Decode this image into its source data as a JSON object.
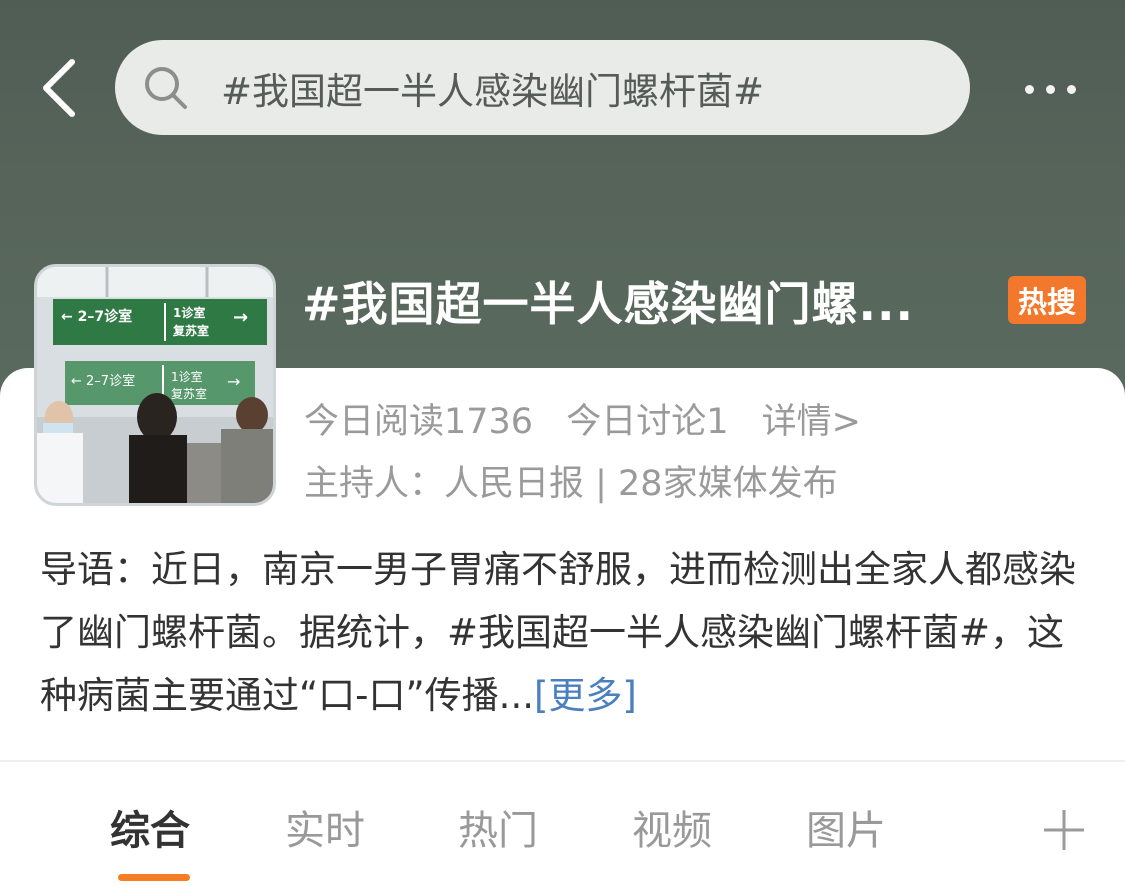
{
  "header": {
    "search_text": "#我国超一半人感染幽门螺杆菌#"
  },
  "topic": {
    "title": "#我国超一半人感染幽门螺...",
    "badge": "热搜",
    "stats": {
      "reads": "今日阅读1736",
      "discussions": "今日讨论1",
      "details": "详情>"
    },
    "host_line": "主持人：人民日报 | 28家媒体发布",
    "thumbnail": {
      "sign_left": "2–7诊室",
      "sign_right_top": "1诊室",
      "sign_right_bottom": "复苏室"
    }
  },
  "intro": {
    "text": "导语：近日，南京一男子胃痛不舒服，进而检测出全家人都感染了幽门螺杆菌。据统计，#我国超一半人感染幽门螺杆菌#，这种病菌主要通过“口-口”传播...",
    "more_label": "[更多]"
  },
  "tabs": [
    {
      "label": "综合",
      "active": true
    },
    {
      "label": "实时",
      "active": false
    },
    {
      "label": "热门",
      "active": false
    },
    {
      "label": "视频",
      "active": false
    },
    {
      "label": "图片",
      "active": false
    }
  ],
  "colors": {
    "header_bg": "#56645a",
    "badge": "#f4782c",
    "accent": "#f77d24",
    "link": "#4a7fc0"
  },
  "icons": {
    "back": "chevron-left-icon",
    "search": "search-icon",
    "more": "more-dots-icon",
    "add": "plus-icon"
  }
}
